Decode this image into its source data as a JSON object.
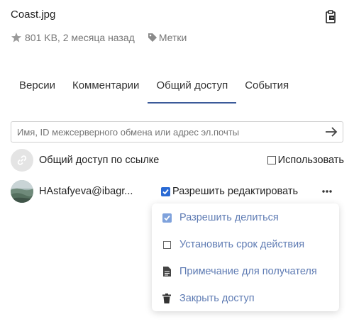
{
  "file": {
    "name": "Coast.jpg",
    "size_info": "801 KB, 2 месяца назад",
    "tags_label": "Метки"
  },
  "tabs": [
    {
      "label": "Версии",
      "active": false
    },
    {
      "label": "Комментарии",
      "active": false
    },
    {
      "label": "Общий доступ",
      "active": true
    },
    {
      "label": "События",
      "active": false
    }
  ],
  "share": {
    "search_placeholder": "Имя, ID межсерверного обмена или адрес эл.почты",
    "link_label": "Общий доступ по ссылке",
    "use_label": "Использовать",
    "use_checked": false
  },
  "user": {
    "email": "HAstafyeva@ibagr...",
    "allow_edit_label": "Разрешить редактировать",
    "allow_edit_checked": true
  },
  "menu": {
    "items": [
      {
        "label": "Разрешить делиться",
        "icon": "checkbox-checked-icon",
        "checked": true
      },
      {
        "label": "Установить срок действия",
        "icon": "checkbox-empty-icon",
        "checked": false
      },
      {
        "label": "Примечание для получателя",
        "icon": "note-icon"
      },
      {
        "label": "Закрыть доступ",
        "icon": "trash-icon"
      }
    ]
  },
  "colors": {
    "accent": "#2a6ad4",
    "tab_underline": "#3b5a99",
    "menu_text": "#5e7bb3",
    "muted_text": "#767676"
  }
}
